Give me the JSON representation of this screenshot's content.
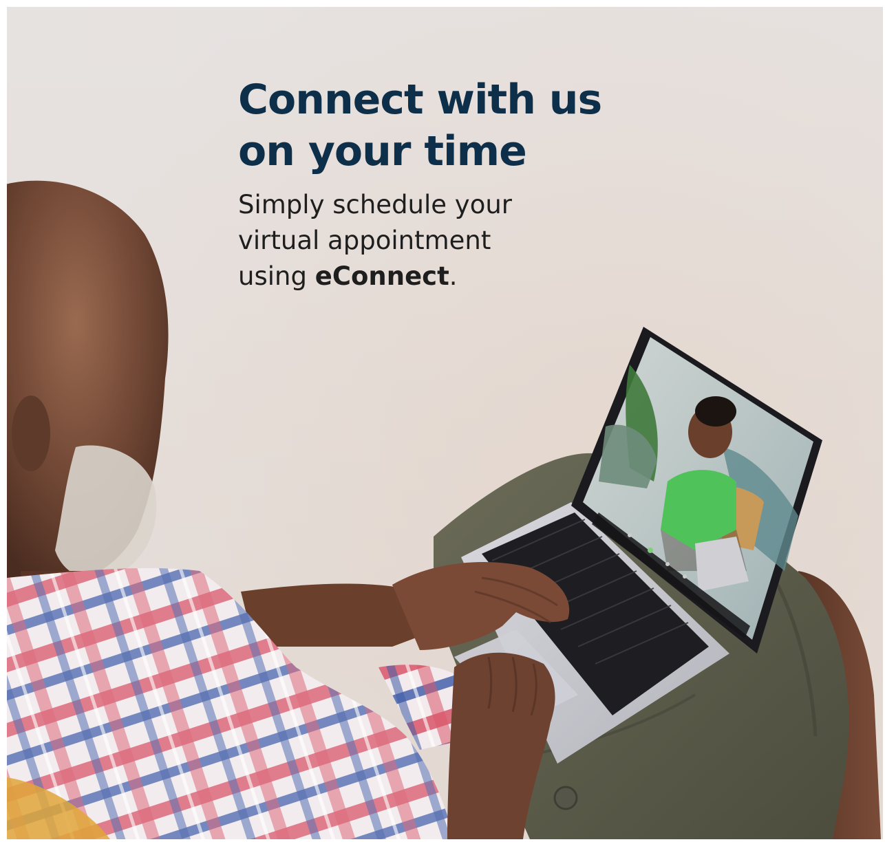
{
  "headline": {
    "line1": "Connect with us",
    "line2": "on your time"
  },
  "subtext": {
    "line1": "Simply schedule your",
    "line2": "virtual appointment",
    "line3_prefix": "using ",
    "brand": "eConnect",
    "line3_suffix": "."
  },
  "colors": {
    "headline": "#0e2f4a",
    "body_text": "#1e1e1e",
    "background_sand": "#e3d8d1",
    "shirt_red": "#d9566a",
    "shirt_blue": "#3d5aa8",
    "shorts": "#5a5a48",
    "laptop": "#c9c9cf",
    "woman_top": "#4fc25a"
  },
  "illustration": {
    "subject": "man-with-laptop-on-beach-icon",
    "screen": "video-call-icon"
  }
}
